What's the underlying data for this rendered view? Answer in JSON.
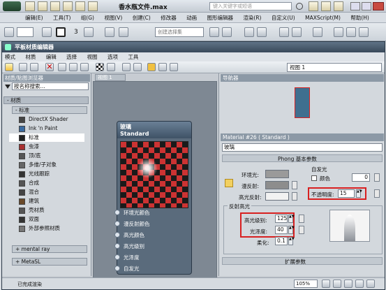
{
  "app": {
    "title": "香水瓶文件.max",
    "search_placeholder": "键入关键字或短语"
  },
  "main_menu": [
    "编辑(E)",
    "工具(T)",
    "组(G)",
    "视图(V)",
    "创建(C)",
    "修改器",
    "动画",
    "图形编辑器",
    "渲染(R)",
    "自定义(U)",
    "MAXScript(M)",
    "帮助(H)"
  ],
  "toolbar": {
    "selection_set_placeholder": "创建选择集",
    "zoom_label": "3"
  },
  "editor": {
    "title": "平板材质编辑器",
    "menu": [
      "模式",
      "材质",
      "编辑",
      "选择",
      "视图",
      "选项",
      "工具"
    ],
    "view_dropdown": "视图 1"
  },
  "browser": {
    "title": "材质/贴图浏览器",
    "search_placeholder": "按名称搜索...",
    "group_materials": "- 材质",
    "group_standard": "- 标准",
    "items": [
      "DirectX Shader",
      "Ink 'n Paint",
      "标准",
      "虫漆",
      "顶/底",
      "多维/子对象",
      "光线跟踪",
      "合成",
      "混合",
      "建筑",
      "壳材质",
      "双面",
      "外部参照材质"
    ],
    "group_mental_ray": "+ mental ray",
    "group_metasl": "+ MetaSL"
  },
  "view_tab": "视图 1",
  "navigator_title": "导航器",
  "node": {
    "name": "玻璃",
    "type": "Standard",
    "slots": [
      "环境光颜色",
      "漫反射颜色",
      "高光颜色",
      "高光级别",
      "光泽度",
      "自发光",
      "不透明度"
    ]
  },
  "props": {
    "header": "Material #26 ( Standard )",
    "name": "玻璃",
    "rollout_phong": "Phong 基本参数",
    "ambient_label": "环境光:",
    "diffuse_label": "漫反射:",
    "specular_label": "高光反射:",
    "self_illum_label": "自发光",
    "color_label": "颜色",
    "self_illum_value": "0",
    "opacity_label": "不透明度:",
    "opacity_value": "15",
    "spec_highlights": "反射高光",
    "spec_level_label": "高光级别:",
    "spec_level_value": "125",
    "glossiness_label": "光泽度:",
    "glossiness_value": "40",
    "soften_label": "柔化:",
    "soften_value": "0.1",
    "rollout_extended": "扩展参数"
  },
  "status": {
    "text": "已完成渲染",
    "zoom": "105%"
  }
}
